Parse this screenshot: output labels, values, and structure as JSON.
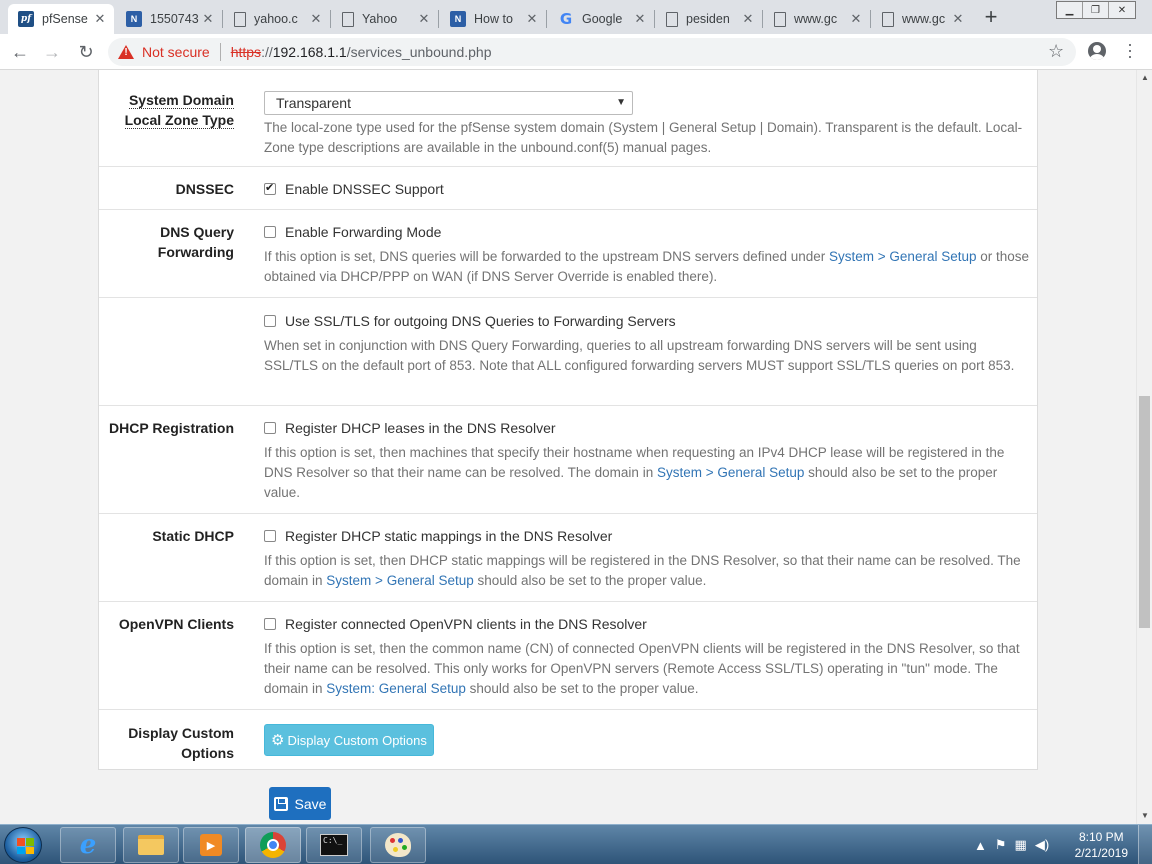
{
  "tabs": [
    {
      "label": "pfSense",
      "favicon": "pfsense",
      "active": true
    },
    {
      "label": "1550743",
      "favicon": "netgate"
    },
    {
      "label": "yahoo.c",
      "favicon": "page"
    },
    {
      "label": "Yahoo",
      "favicon": "page"
    },
    {
      "label": "How to",
      "favicon": "netgate"
    },
    {
      "label": "Google",
      "favicon": "google"
    },
    {
      "label": "pesiden",
      "favicon": "page"
    },
    {
      "label": "www.gc",
      "favicon": "page"
    },
    {
      "label": "www.gc",
      "favicon": "page"
    }
  ],
  "tab_close_glyph": "✕",
  "new_tab_glyph": "+",
  "address_bar": {
    "security_label": "Not secure",
    "url_scheme": "https",
    "url_sep": "://",
    "url_host": "192.168.1.1",
    "url_path": "/services_unbound.php"
  },
  "settings": [
    {
      "label_line1": "System Domain",
      "label_line2": "Local Zone Type",
      "select_value": "Transparent",
      "help": "The local-zone type used for the pfSense system domain (System | General Setup | Domain). Transparent is the default. Local-Zone type descriptions are available in the unbound.conf(5) manual pages."
    },
    {
      "label": "DNSSEC",
      "checkbox_label": "Enable DNSSEC Support",
      "checked": true
    },
    {
      "label_line1": "DNS Query",
      "label_line2": "Forwarding",
      "checkbox_label": "Enable Forwarding Mode",
      "checked": false,
      "help_before": "If this option is set, DNS queries will be forwarded to the upstream DNS servers defined under ",
      "help_link": "System > General Setup",
      "help_after": " or those obtained via DHCP/PPP on WAN (if DNS Server Override is enabled there)."
    },
    {
      "label": "",
      "checkbox_label": "Use SSL/TLS for outgoing DNS Queries to Forwarding Servers",
      "checked": false,
      "help": "When set in conjunction with DNS Query Forwarding, queries to all upstream forwarding DNS servers will be sent using SSL/TLS on the default port of 853. Note that ALL configured forwarding servers MUST support SSL/TLS queries on port 853."
    },
    {
      "label": "DHCP Registration",
      "checkbox_label": "Register DHCP leases in the DNS Resolver",
      "checked": false,
      "help_before": "If this option is set, then machines that specify their hostname when requesting an IPv4 DHCP lease will be registered in the DNS Resolver so that their name can be resolved. The domain in ",
      "help_link": "System > General Setup",
      "help_after": " should also be set to the proper value."
    },
    {
      "label": "Static DHCP",
      "checkbox_label": "Register DHCP static mappings in the DNS Resolver",
      "checked": false,
      "help_before": "If this option is set, then DHCP static mappings will be registered in the DNS Resolver, so that their name can be resolved. The domain in ",
      "help_link": "System > General Setup",
      "help_after": " should also be set to the proper value."
    },
    {
      "label": "OpenVPN Clients",
      "checkbox_label": "Register connected OpenVPN clients in the DNS Resolver",
      "checked": false,
      "help_before": "If this option is set, then the common name (CN) of connected OpenVPN clients will be registered in the DNS Resolver, so that their name can be resolved. This only works for OpenVPN servers (Remote Access SSL/TLS) operating in \"tun\" mode. The domain in ",
      "help_link": "System: General Setup",
      "help_after": " should also be set to the proper value."
    },
    {
      "label_line1": "Display Custom",
      "label_line2": "Options",
      "button_label": "Display Custom Options"
    }
  ],
  "save_label": "Save",
  "taskbar": {
    "time": "8:10 PM",
    "date": "2/21/2019"
  },
  "colors": {
    "link": "#3275b5",
    "info_button": "#5bc0de",
    "save_button": "#1e6fbf",
    "not_secure": "#d93025"
  }
}
